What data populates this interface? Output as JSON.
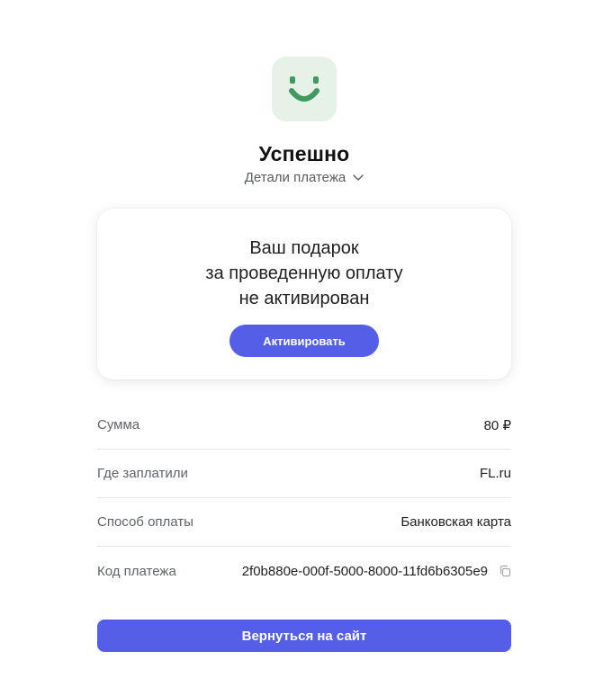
{
  "header": {
    "logo_icon": "smiley-face-icon",
    "title": "Успешно",
    "details_toggle_label": "Детали платежа",
    "details_toggle_icon": "chevron-down-icon"
  },
  "gift_card": {
    "lines": [
      "Ваш подарок",
      "за проведенную оплату",
      "не активирован"
    ],
    "activate_label": "Активировать"
  },
  "details": {
    "rows": [
      {
        "label": "Сумма",
        "value": "80 ₽"
      },
      {
        "label": "Где заплатили",
        "value": "FL.ru"
      },
      {
        "label": "Способ оплаты",
        "value": "Банковская карта"
      },
      {
        "label": "Код платежа",
        "value": "2f0b880e-000f-5000-8000-11fd6b6305e9",
        "icon": "copy-icon"
      }
    ]
  },
  "footer": {
    "return_label": "Вернуться на сайт"
  },
  "colors": {
    "accent": "#545ee6",
    "logo_bg": "#e6f1e8",
    "logo_fg": "#3f9a5f"
  }
}
